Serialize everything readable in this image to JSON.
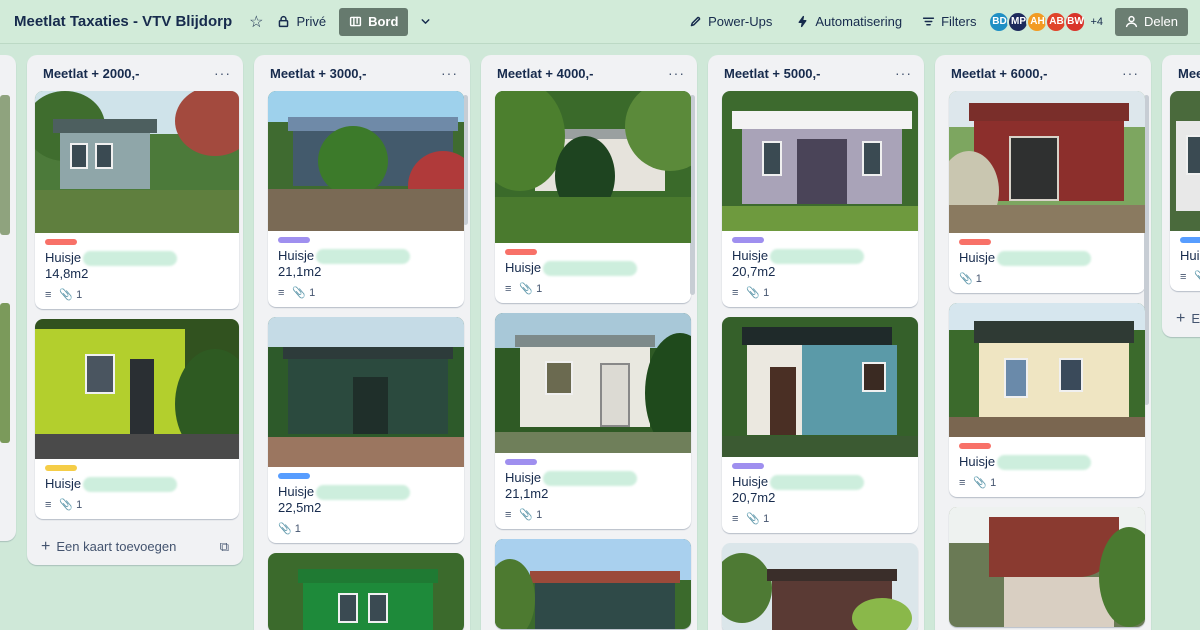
{
  "header": {
    "board_title": "Meetlat Taxaties - VTV Blijdorp",
    "visibility": "Privé",
    "view": "Bord",
    "power_ups": "Power-Ups",
    "automation": "Automatisering",
    "filters": "Filters",
    "share": "Delen",
    "more_members": "+4",
    "members": [
      {
        "initials": "BD",
        "color": "#1f8fc4"
      },
      {
        "initials": "MP",
        "color": "#1d2a5c"
      },
      {
        "initials": "AH",
        "color": "#f29b24"
      },
      {
        "initials": "AB",
        "color": "#e0442a"
      },
      {
        "initials": "BW",
        "color": "#d9342b"
      }
    ]
  },
  "lists": [
    {
      "title": "Meetlat + 2000,-",
      "add_card": "Een kaart toevoegen",
      "cards": [
        {
          "title": "Huisje",
          "size": "14,8m2",
          "label_color": "#f87168",
          "attachments": "1"
        },
        {
          "title": "Huisje",
          "size": "",
          "label_color": "#f5cd47",
          "attachments": "1"
        }
      ]
    },
    {
      "title": "Meetlat + 3000,-",
      "cards": [
        {
          "title": "Huisje",
          "size": "21,1m2",
          "label_color": "#9f8fef",
          "attachments": "1"
        },
        {
          "title": "Huisje",
          "size": "22,5m2",
          "label_color": "#579dff",
          "attachments": "1"
        }
      ]
    },
    {
      "title": "Meetlat + 4000,-",
      "cards": [
        {
          "title": "Huisje",
          "size": "",
          "label_color": "#f87168",
          "attachments": "1"
        },
        {
          "title": "Huisje",
          "size": "21,1m2",
          "label_color": "#9f8fef",
          "attachments": "1"
        }
      ]
    },
    {
      "title": "Meetlat + 5000,-",
      "cards": [
        {
          "title": "Huisje",
          "size": "20,7m2",
          "label_color": "#9f8fef",
          "attachments": "1"
        },
        {
          "title": "Huisje",
          "size": "20,7m2",
          "label_color": "#9f8fef",
          "attachments": "1"
        }
      ]
    },
    {
      "title": "Meetlat + 6000,-",
      "cards": [
        {
          "title": "Huisje",
          "size": "",
          "label_color": "#f87168",
          "attachments": "1"
        },
        {
          "title": "Huisje",
          "size": "",
          "label_color": "#f87168",
          "attachments": "1"
        }
      ]
    },
    {
      "title": "Mee",
      "add_card": "E",
      "cards": [
        {
          "title": "Huis",
          "size": "",
          "label_color": "#579dff",
          "attachments": "1"
        }
      ]
    }
  ]
}
